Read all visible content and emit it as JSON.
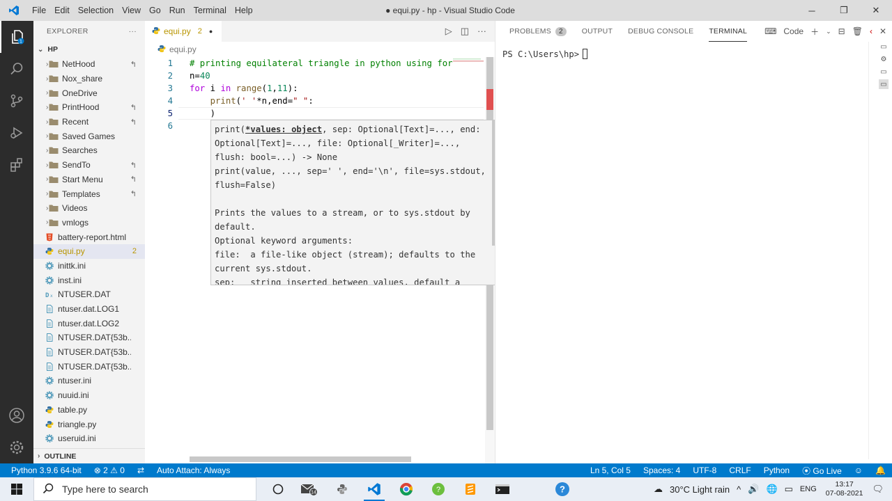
{
  "window": {
    "title": "● equi.py - hp - Visual Studio Code",
    "menu": [
      "File",
      "Edit",
      "Selection",
      "View",
      "Go",
      "Run",
      "Terminal",
      "Help"
    ]
  },
  "explorer": {
    "header": "EXPLORER",
    "root": "HP",
    "items": [
      {
        "label": "NetHood",
        "type": "folder",
        "badge": "↰"
      },
      {
        "label": "Nox_share",
        "type": "folder",
        "badge": ""
      },
      {
        "label": "OneDrive",
        "type": "folder",
        "badge": ""
      },
      {
        "label": "PrintHood",
        "type": "folder",
        "badge": "↰"
      },
      {
        "label": "Recent",
        "type": "folder",
        "badge": "↰"
      },
      {
        "label": "Saved Games",
        "type": "folder",
        "badge": ""
      },
      {
        "label": "Searches",
        "type": "folder",
        "badge": ""
      },
      {
        "label": "SendTo",
        "type": "folder",
        "badge": "↰"
      },
      {
        "label": "Start Menu",
        "type": "folder",
        "badge": "↰"
      },
      {
        "label": "Templates",
        "type": "folder",
        "badge": "↰"
      },
      {
        "label": "Videos",
        "type": "folder",
        "badge": ""
      },
      {
        "label": "vmlogs",
        "type": "folder",
        "badge": ""
      },
      {
        "label": "battery-report.html",
        "type": "html",
        "badge": ""
      },
      {
        "label": "equi.py",
        "type": "py",
        "badge": "2"
      },
      {
        "label": "inittk.ini",
        "type": "ini",
        "badge": ""
      },
      {
        "label": "inst.ini",
        "type": "ini",
        "badge": ""
      },
      {
        "label": "NTUSER.DAT",
        "type": "dat",
        "badge": ""
      },
      {
        "label": "ntuser.dat.LOG1",
        "type": "file",
        "badge": ""
      },
      {
        "label": "ntuser.dat.LOG2",
        "type": "file",
        "badge": ""
      },
      {
        "label": "NTUSER.DAT{53b...",
        "type": "file",
        "badge": ""
      },
      {
        "label": "NTUSER.DAT{53b...",
        "type": "file",
        "badge": ""
      },
      {
        "label": "NTUSER.DAT{53b...",
        "type": "file",
        "badge": ""
      },
      {
        "label": "ntuser.ini",
        "type": "ini",
        "badge": ""
      },
      {
        "label": "nuuid.ini",
        "type": "ini",
        "badge": ""
      },
      {
        "label": "table.py",
        "type": "py",
        "badge": ""
      },
      {
        "label": "triangle.py",
        "type": "py",
        "badge": ""
      },
      {
        "label": "useruid.ini",
        "type": "ini",
        "badge": ""
      }
    ],
    "selected_index": 13,
    "outline": "OUTLINE"
  },
  "editor": {
    "tab": {
      "name": "equi.py",
      "problems": "2",
      "dirty": "●"
    },
    "breadcrumb": "equi.py",
    "current_line": "5",
    "line_numbers": [
      "1",
      "2",
      "3",
      "4",
      "5",
      "6"
    ],
    "code": {
      "l1": "# printing equilateral triangle in python using for",
      "l2_var": "n=",
      "l2_num": "40",
      "l3_kw1": "for",
      "l3_mid": " i ",
      "l3_kw2": "in",
      "l3_fn": " range",
      "l3_args_a": "(",
      "l3_n1": "1",
      "l3_comma": ",",
      "l3_n2": "11",
      "l3_end": "):",
      "l4_fn": "print",
      "l4_a": "(",
      "l4_s1": "' '",
      "l4_b": "*n,end=",
      "l4_s2": "\" \"",
      "l4_c": ":",
      "l5": ")"
    },
    "hover": {
      "sig_a": "print(",
      "sig_b": "*values: object",
      "sig_c": ", sep: Optional[Text]=..., end: Optional[Text]=..., file: Optional[_Writer]=..., flush: bool=...) -> None",
      "sig2": "print(value, ..., sep=' ', end='\\n', file=sys.stdout, flush=False)",
      "desc1": "Prints the values to a stream, or to sys.stdout by default.",
      "desc2": "Optional keyword arguments:",
      "desc3": "file:  a file-like object (stream); defaults to the current sys.stdout.",
      "desc4": "sep:   string inserted between values, default a space."
    }
  },
  "panel": {
    "tabs": [
      "PROBLEMS",
      "OUTPUT",
      "DEBUG CONSOLE",
      "TERMINAL"
    ],
    "problems_count": "2",
    "active_tab": "TERMINAL",
    "terminal_name": "Code",
    "prompt": "PS C:\\Users\\hp>"
  },
  "statusbar": {
    "python": "Python 3.9.6 64-bit",
    "errors": "2",
    "warnings": "0",
    "attach": "Auto Attach: Always",
    "position": "Ln 5, Col 5",
    "spaces": "Spaces: 4",
    "encoding": "UTF-8",
    "eol": "CRLF",
    "language": "Python",
    "golive": "Go Live"
  },
  "taskbar": {
    "search_placeholder": "Type here to search",
    "mail_count": "14",
    "weather": "30°C  Light rain",
    "lang": "ENG",
    "time": "13:17",
    "date": "07-08-2021"
  },
  "colors": {
    "accent": "#007acc",
    "activitybar": "#2c2c2c",
    "modified": "#b89500"
  }
}
